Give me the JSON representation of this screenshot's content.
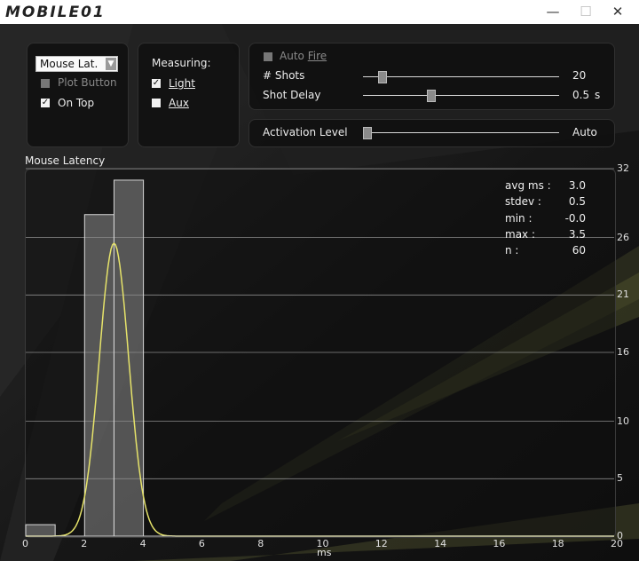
{
  "window": {
    "logo": "MOBILE01",
    "min_glyph": "—",
    "max_glyph": "☐",
    "close_glyph": "✕"
  },
  "panel_mode": {
    "mode_select": {
      "value": "Mouse Lat.",
      "arrow": "▼"
    },
    "plot_button": {
      "label": "Plot Button",
      "checked": false,
      "enabled": false
    },
    "on_top": {
      "label": "On Top",
      "checked": true
    }
  },
  "panel_measuring": {
    "title": "Measuring:",
    "light": {
      "label": "Light",
      "checked": true
    },
    "aux": {
      "label": "Aux",
      "checked": false
    }
  },
  "panel_fire": {
    "auto_fire": {
      "label_a": "Auto",
      "label_b": "Fire",
      "checked": false,
      "enabled": false
    },
    "shots": {
      "label": "# Shots",
      "value": "20",
      "level": 0.08
    },
    "shot_delay": {
      "label": "Shot Delay",
      "value": "0.5",
      "unit": "s",
      "level": 0.34
    }
  },
  "activation": {
    "label": "Activation Level",
    "value": "Auto",
    "level": 0.0
  },
  "plot": {
    "title": "Mouse Latency",
    "xlabel": "ms"
  },
  "stats": [
    {
      "label": "avg ms :",
      "value": "3.0"
    },
    {
      "label": "stdev :",
      "value": "0.5"
    },
    {
      "label": "min :",
      "value": "-0.0"
    },
    {
      "label": "max :",
      "value": "3.5"
    },
    {
      "label": "n :",
      "value": "60"
    }
  ],
  "colors": {
    "curve": "#e6e36a",
    "bar_fill": "#8a8a8a",
    "gridline": "#bdbdbd"
  },
  "chart_data": {
    "type": "bar",
    "title": "Mouse Latency",
    "xlabel": "ms",
    "ylabel": "",
    "xlim": [
      0,
      20
    ],
    "ylim": [
      0,
      32
    ],
    "x_ticks": [
      0,
      2,
      4,
      6,
      8,
      10,
      12,
      14,
      16,
      18,
      20
    ],
    "y_ticks": [
      0,
      5,
      10,
      16,
      21,
      26,
      32
    ],
    "y_axis_side": "right",
    "grid": true,
    "bins": [
      {
        "x0": 0,
        "x1": 1,
        "count": 1
      },
      {
        "x0": 2,
        "x1": 3,
        "count": 28
      },
      {
        "x0": 3,
        "x1": 4,
        "count": 31
      }
    ],
    "curve": {
      "type": "gaussian",
      "mean": 3.0,
      "stdev": 0.5,
      "peak": 25.5
    }
  }
}
